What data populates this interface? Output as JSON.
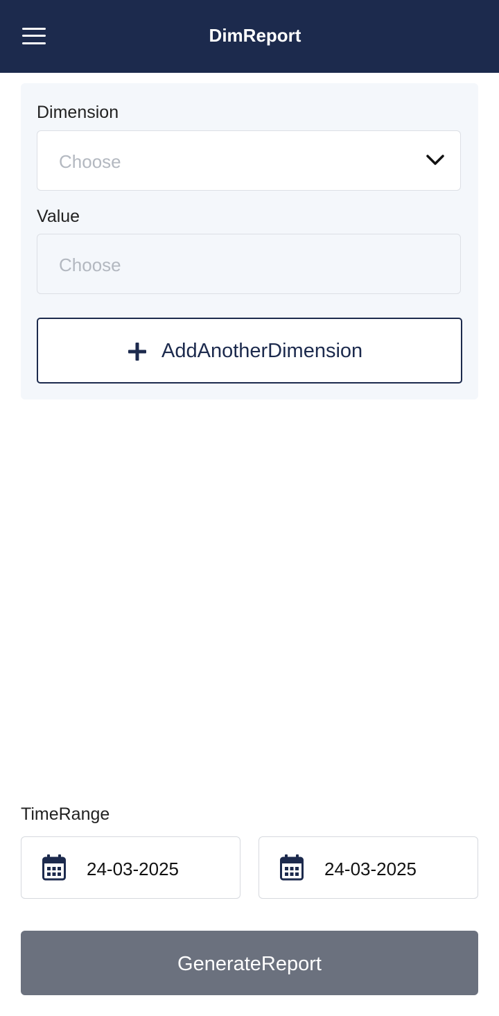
{
  "header": {
    "title": "DimReport",
    "menu_icon": "hamburger-menu-icon"
  },
  "filter_panel": {
    "dimension_label": "Dimension",
    "dimension_placeholder": "Choose",
    "dimension_icon": "chevron-down-icon",
    "value_label": "Value",
    "value_placeholder": "Choose",
    "add_button_label": "AddAnotherDimension",
    "add_button_icon": "plus-icon"
  },
  "time_range": {
    "label": "TimeRange",
    "start_date": "24-03-2025",
    "end_date": "24-03-2025",
    "date_icon": "calendar-icon"
  },
  "generate_button_label": "GenerateReport",
  "colors": {
    "header_bg": "#1c2a4d",
    "panel_bg": "#f4f7fb",
    "button_disabled_bg": "#6b717e",
    "accent": "#1c2a4d"
  }
}
